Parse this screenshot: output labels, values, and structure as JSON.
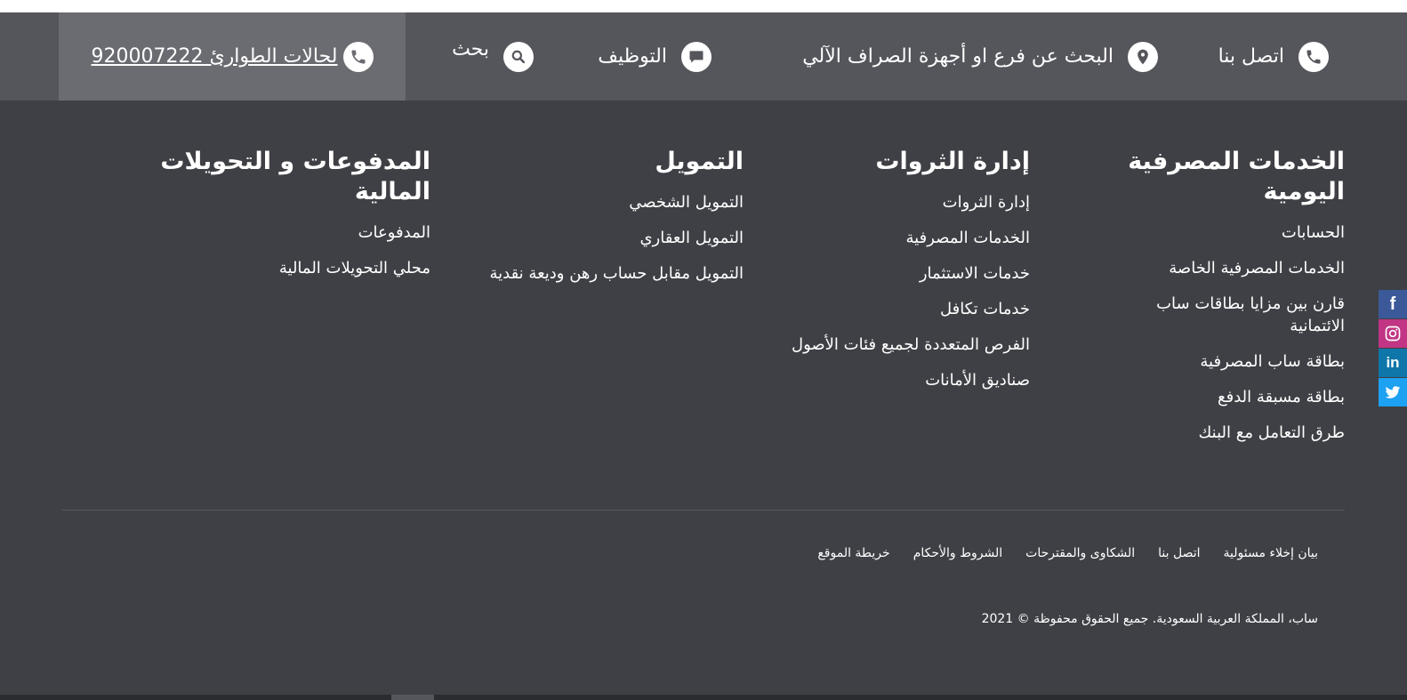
{
  "utility": {
    "contact_label": "اتصل بنا",
    "branch_search_label": "البحث عن فرع او أجهزة الصراف الآلي",
    "careers_label": "التوظيف",
    "search_label": "بحث",
    "emergency_label": "لحالات الطوارئ 920007222"
  },
  "columns": [
    {
      "title": "الخدمات المصرفية اليومية",
      "items": [
        "الحسابات",
        "الخدمات المصرفية الخاصة",
        "قارن بين مزايا بطاقات ساب الائتمانية",
        "بطاقة ساب المصرفية",
        "بطاقة مسبقة الدفع",
        "طرق التعامل مع البنك"
      ]
    },
    {
      "title": "إدارة الثروات",
      "items": [
        "إدارة الثروات",
        "الخدمات المصرفية",
        "خدمات الاستثمار",
        "خدمات تكافل",
        "الفرص المتعددة لجميع فئات الأصول",
        "صناديق الأمانات"
      ]
    },
    {
      "title": "التمويل",
      "items": [
        "التمويل الشخصي",
        "التمويل العقاري",
        "التمويل مقابل حساب رهن وديعة نقدية"
      ]
    },
    {
      "title": "المدفوعات و التحويلات المالية",
      "items": [
        "المدفوعات",
        "محلي التحويلات المالية"
      ]
    }
  ],
  "legal_links": [
    "بيان إخلاء مسئولية",
    "اتصل بنا",
    "الشكاوى والمقترحات",
    "الشروط والأحكام",
    "خريطة الموقع"
  ],
  "copyright": "ساب، المملكة العربية السعودية. جميع الحقوق محفوظة © 2021",
  "social": {
    "facebook_glyph": "f",
    "linkedin_glyph": "in",
    "facebook_color": "#3b5998",
    "instagram_color": "#c13584",
    "linkedin_color": "#0e76a8",
    "twitter_color": "#1da1f2"
  },
  "colors": {
    "footer_bg": "#3f4045",
    "utility_bg": "#55565c",
    "emergency_bg": "#6b6c71",
    "icon_glyph": "#55565c"
  }
}
